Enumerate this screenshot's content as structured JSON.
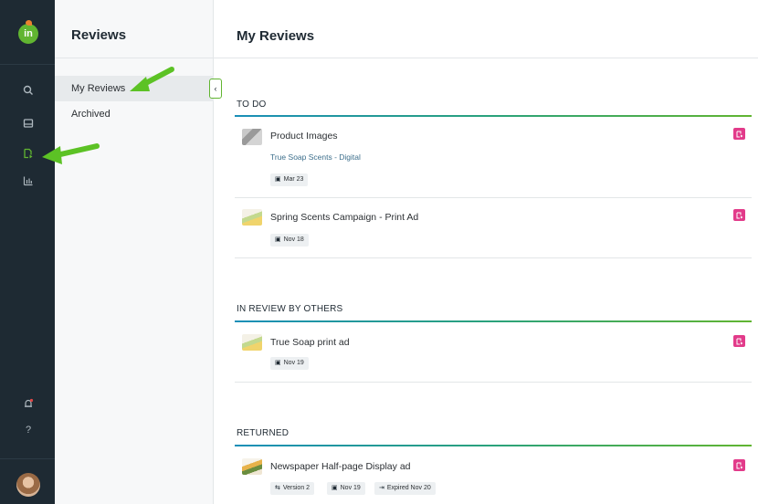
{
  "rail": {
    "logo_text": "in",
    "icons": [
      "search-icon",
      "inbox-icon",
      "review-icon",
      "analytics-icon",
      "notifications-icon",
      "help-icon"
    ],
    "help_text": "?"
  },
  "subnav": {
    "title": "Reviews",
    "items": [
      {
        "label": "My Reviews",
        "active": true
      },
      {
        "label": "Archived",
        "active": false
      }
    ],
    "collapse_glyph": "‹"
  },
  "main": {
    "title": "My Reviews",
    "sections": [
      {
        "title": "TO DO",
        "items": [
          {
            "title": "Product Images",
            "subtitle": "True Soap Scents - Digital",
            "chips": [
              {
                "icon": "calendar-icon",
                "text": "Mar 23"
              }
            ]
          },
          {
            "title": "Spring Scents Campaign - Print Ad",
            "subtitle": "",
            "chips": [
              {
                "icon": "calendar-icon",
                "text": "Nov 18"
              }
            ]
          }
        ]
      },
      {
        "title": "IN REVIEW BY OTHERS",
        "items": [
          {
            "title": "True Soap print ad",
            "subtitle": "",
            "chips": [
              {
                "icon": "calendar-icon",
                "text": "Nov 19"
              }
            ]
          }
        ]
      },
      {
        "title": "RETURNED",
        "items": [
          {
            "title": "Newspaper Half-page Display ad",
            "subtitle": "",
            "chips": [
              {
                "icon": "version-icon",
                "text": "Version 2"
              },
              {
                "icon": "calendar-icon",
                "text": "Nov 19"
              },
              {
                "icon": "expired-icon",
                "text": "Expired Nov 20"
              }
            ]
          }
        ]
      }
    ]
  },
  "colors": {
    "rail_bg": "#1e2a33",
    "brand_green": "#61b531",
    "accent_pink": "#e23b8a",
    "link_blue": "#3d6f8c"
  }
}
